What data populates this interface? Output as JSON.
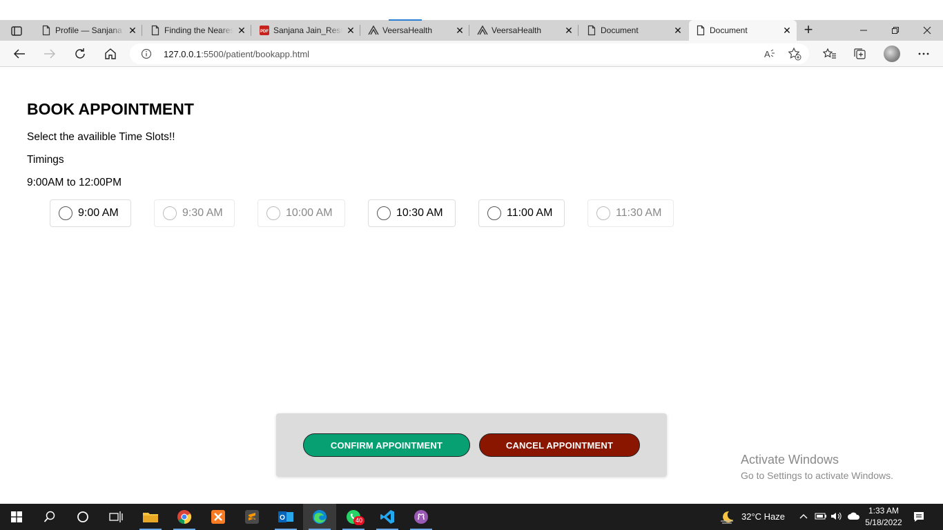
{
  "browser": {
    "tabs": [
      {
        "title": "Profile — Sanjana",
        "icon": "page-icon"
      },
      {
        "title": "Finding the Nearest",
        "icon": "page-icon"
      },
      {
        "title": "Sanjana Jain_Resume",
        "icon": "pdf-icon"
      },
      {
        "title": "VeersaHealth",
        "icon": "veersa-icon"
      },
      {
        "title": "VeersaHealth",
        "icon": "veersa-icon"
      },
      {
        "title": "Document",
        "icon": "page-icon"
      },
      {
        "title": "Document",
        "icon": "page-icon",
        "active": true
      }
    ],
    "url_host": "127.0.0.1",
    "url_rest": ":5500/patient/bookapp.html"
  },
  "page": {
    "title": "BOOK APPOINTMENT",
    "subtitle": "Select the availible Time Slots!!",
    "timings_label": "Timings",
    "timings_range": "9:00AM to 12:00PM",
    "slots": [
      {
        "label": "9:00 AM",
        "available": true
      },
      {
        "label": "9:30 AM",
        "available": false
      },
      {
        "label": "10:00 AM",
        "available": false
      },
      {
        "label": "10:30 AM",
        "available": true
      },
      {
        "label": "11:00 AM",
        "available": true
      },
      {
        "label": "11:30 AM",
        "available": false
      }
    ],
    "confirm_label": "CONFIRM APPOINTMENT",
    "cancel_label": "CANCEL APPOINTMENT",
    "confirm_color": "#06a073",
    "cancel_color": "#8b1600"
  },
  "watermark": {
    "line1": "Activate Windows",
    "line2": "Go to Settings to activate Windows."
  },
  "taskbar": {
    "whatsapp_badge": "40",
    "weather": "32°C  Haze",
    "time": "1:33 AM",
    "date": "5/18/2022"
  }
}
